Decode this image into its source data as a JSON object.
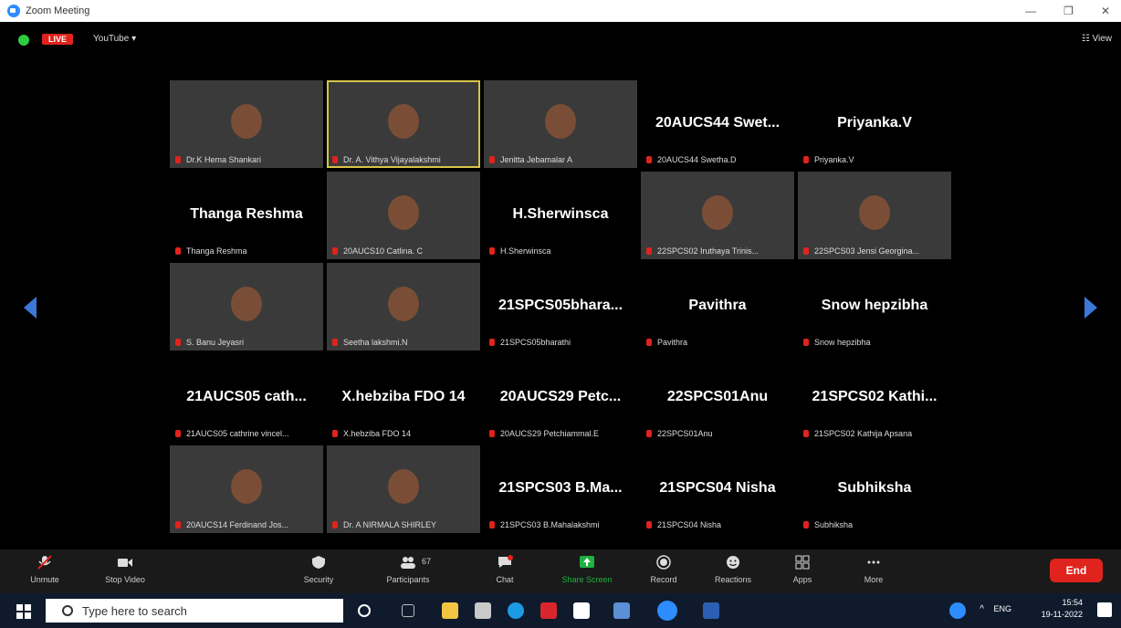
{
  "window": {
    "title": "Zoom Meeting",
    "minimize": "—",
    "restore": "❐",
    "close": "✕"
  },
  "topbar": {
    "live": "LIVE",
    "youtube": "YouTube ▾",
    "view": "☷ View"
  },
  "tiles": [
    {
      "name": "Dr.K Hema Shankari",
      "display": "",
      "video": "v1",
      "active": false
    },
    {
      "name": "Dr. A. Vithya Vijayalakshmi",
      "display": "",
      "video": "v2",
      "active": true
    },
    {
      "name": "Jenitta Jebamalar A",
      "display": "",
      "video": "v3",
      "active": false
    },
    {
      "name": "20AUCS44 Swetha.D",
      "display": "20AUCS44 Swet...",
      "video": "",
      "active": false
    },
    {
      "name": "Priyanka.V",
      "display": "Priyanka.V",
      "video": "",
      "active": false
    },
    {
      "name": "Thanga Reshma",
      "display": "Thanga Reshma",
      "video": "",
      "active": false
    },
    {
      "name": "20AUCS10 Catlina. C",
      "display": "",
      "video": "v4",
      "active": false
    },
    {
      "name": "H.Sherwinsca",
      "display": "H.Sherwinsca",
      "video": "",
      "active": false
    },
    {
      "name": "22SPCS02 Iruthaya Trinis...",
      "display": "",
      "video": "v5",
      "active": false
    },
    {
      "name": "22SPCS03 Jensi Georgina...",
      "display": "",
      "video": "v6",
      "active": false
    },
    {
      "name": "S. Banu Jeyasri",
      "display": "",
      "video": "v7",
      "active": false
    },
    {
      "name": "Seetha lakshmi.N",
      "display": "",
      "video": "v8",
      "active": false
    },
    {
      "name": "21SPCS05bharathi",
      "display": "21SPCS05bhara...",
      "video": "",
      "active": false
    },
    {
      "name": "Pavithra",
      "display": "Pavithra",
      "video": "",
      "active": false
    },
    {
      "name": "Snow hepzibha",
      "display": "Snow hepzibha",
      "video": "",
      "active": false
    },
    {
      "name": "21AUCS05 cathrine vincel...",
      "display": "21AUCS05 cath...",
      "video": "",
      "active": false
    },
    {
      "name": "X.hebziba FDO 14",
      "display": "X.hebziba FDO 14",
      "video": "",
      "active": false
    },
    {
      "name": "20AUCS29 Petchiammal.E",
      "display": "20AUCS29 Petc...",
      "video": "",
      "active": false
    },
    {
      "name": "22SPCS01Anu",
      "display": "22SPCS01Anu",
      "video": "",
      "active": false
    },
    {
      "name": "21SPCS02 Kathija Apsana",
      "display": "21SPCS02 Kathi...",
      "video": "",
      "active": false
    },
    {
      "name": "20AUCS14 Ferdinand Jos...",
      "display": "",
      "video": "v9",
      "active": false
    },
    {
      "name": "Dr. A NIRMALA SHIRLEY",
      "display": "",
      "video": "v10",
      "active": false
    },
    {
      "name": "21SPCS03 B.Mahalakshmi",
      "display": "21SPCS03 B.Ma...",
      "video": "",
      "active": false
    },
    {
      "name": "21SPCS04 Nisha",
      "display": "21SPCS04 Nisha",
      "video": "",
      "active": false
    },
    {
      "name": "Subhiksha",
      "display": "Subhiksha",
      "video": "",
      "active": false
    }
  ],
  "toolbar": {
    "unmute": "Unmute",
    "stop_video": "Stop Video",
    "security": "Security",
    "participants": "Participants",
    "participants_count": "67",
    "chat": "Chat",
    "share_screen": "Share Screen",
    "record": "Record",
    "reactions": "Reactions",
    "apps": "Apps",
    "more": "More",
    "end": "End"
  },
  "taskbar": {
    "search_placeholder": "Type here to search",
    "lang": "ENG",
    "time": "15:54",
    "date": "19-11-2022"
  },
  "colors": {
    "accent": "#2d8cff",
    "live": "#e0231c",
    "share": "#1fb141",
    "active_border": "#d8c44b"
  }
}
